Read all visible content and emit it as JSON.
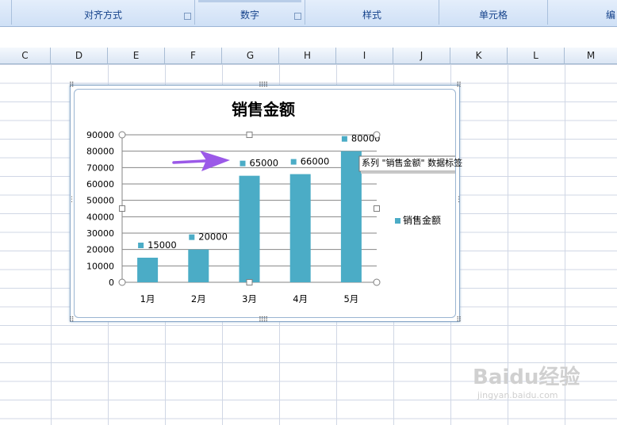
{
  "ribbon": {
    "groups": [
      {
        "label": "对齐方式"
      },
      {
        "label": "数字"
      },
      {
        "label": "样式"
      },
      {
        "label": "单元格"
      },
      {
        "label": "编"
      }
    ]
  },
  "columns": [
    "C",
    "D",
    "E",
    "F",
    "G",
    "H",
    "I",
    "J",
    "K",
    "L",
    "M"
  ],
  "chart_data": {
    "type": "bar",
    "title": "销售金额",
    "categories": [
      "1月",
      "2月",
      "3月",
      "4月",
      "5月"
    ],
    "series": [
      {
        "name": "销售金额",
        "values": [
          15000,
          20000,
          65000,
          66000,
          80000
        ],
        "color": "#4bacc6"
      }
    ],
    "data_labels": [
      "15000",
      "20000",
      "65000",
      "66000",
      "80000"
    ],
    "ylim": [
      0,
      90000
    ],
    "yticks": [
      "0",
      "10000",
      "20000",
      "30000",
      "40000",
      "50000",
      "60000",
      "70000",
      "80000",
      "90000"
    ],
    "grid": true,
    "legend": "right",
    "tooltip": "系列 \"销售金额\" 数据标签",
    "arrow_color": "#9b59e8"
  },
  "watermark": {
    "brand": "Baidu经验",
    "url": "jingyan.baidu.com"
  }
}
